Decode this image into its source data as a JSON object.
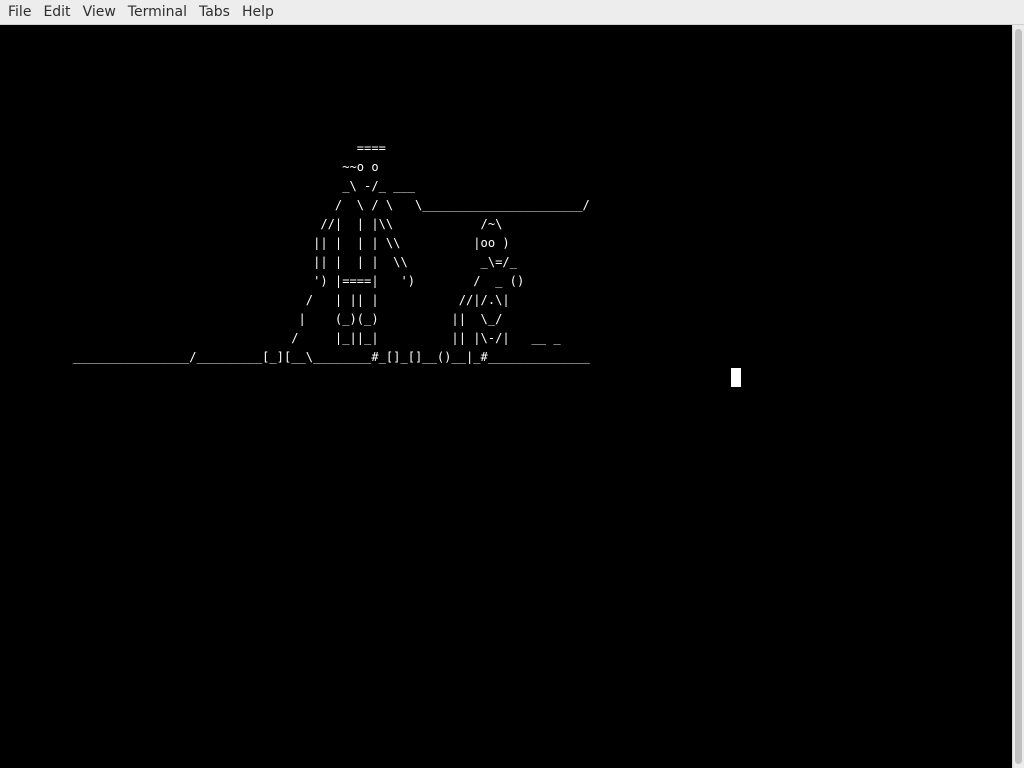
{
  "menubar": {
    "items": [
      {
        "label": "File"
      },
      {
        "label": "Edit"
      },
      {
        "label": "View"
      },
      {
        "label": "Terminal"
      },
      {
        "label": "Tabs"
      },
      {
        "label": "Help"
      }
    ]
  },
  "terminal": {
    "lines": [
      "",
      "",
      "",
      "",
      "",
      "",
      "                                                 ====",
      "                                               ~~o o                                                                                                                __",
      "                                               _\\ -/_ ___                                                                                               ______/",
      "                                              /  \\ / \\   \\______________________/",
      "                                            //|  | |\\\\            /~\\",
      "                                           || |  | | \\\\          |oo )",
      "                                           || |  | |  \\\\          _\\=/_",
      "                                           ') |====|   ')        /  _ ()",
      "                                          /   | || |           //|/.\\|",
      "                                         |    (_)(_)          ||  \\_/",
      "                                        /     |_||_|          || |\\-/|   __ _",
      "          ________________/_________[_][__\\________#_[]_[]__()__|_#______________"
    ]
  },
  "colors": {
    "terminal_background": "#000000",
    "terminal_foreground": "#ffffff",
    "menubar_background": "#ededed"
  }
}
